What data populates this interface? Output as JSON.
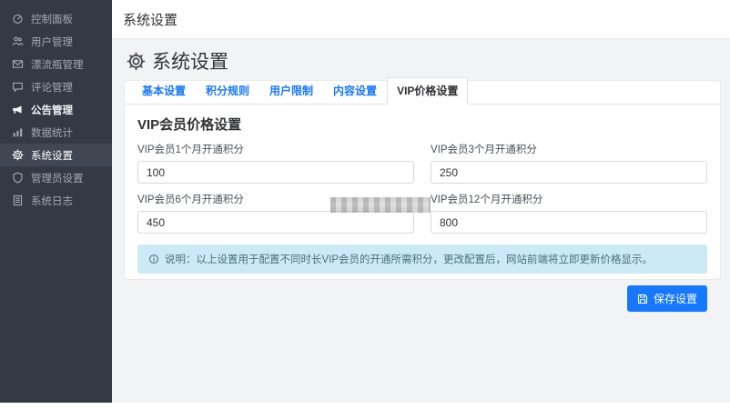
{
  "sidebar": {
    "items": [
      {
        "label": "控制面板",
        "icon": "dashboard-icon"
      },
      {
        "label": "用户管理",
        "icon": "users-icon"
      },
      {
        "label": "漂流瓶管理",
        "icon": "envelope-icon"
      },
      {
        "label": "评论管理",
        "icon": "comment-icon"
      },
      {
        "label": "公告管理",
        "icon": "megaphone-icon"
      },
      {
        "label": "数据统计",
        "icon": "bar-chart-icon"
      },
      {
        "label": "系统设置",
        "icon": "gear-icon"
      },
      {
        "label": "管理员设置",
        "icon": "admin-shield-icon"
      },
      {
        "label": "系统日志",
        "icon": "log-icon"
      }
    ],
    "active_item": "系统设置"
  },
  "topbar": {
    "title": "系统设置"
  },
  "page": {
    "title": "系统设置"
  },
  "tabs": {
    "items": [
      {
        "label": "基本设置"
      },
      {
        "label": "积分规则"
      },
      {
        "label": "用户限制"
      },
      {
        "label": "内容设置"
      },
      {
        "label": "VIP价格设置"
      }
    ],
    "active_tab": "VIP价格设置"
  },
  "form": {
    "section_title": "VIP会员价格设置",
    "fields": [
      {
        "label": "VIP会员1个月开通积分",
        "value": "100"
      },
      {
        "label": "VIP会员3个月开通积分",
        "value": "250"
      },
      {
        "label": "VIP会员6个月开通积分",
        "value": "450"
      },
      {
        "label": "VIP会员12个月开通积分",
        "value": "800"
      }
    ]
  },
  "notice": {
    "text": "说明：以上设置用于配置不同时长VIP会员的开通所需积分，更改配置后，网站前端将立即更新价格显示。"
  },
  "actions": {
    "save_label": "保存设置"
  },
  "colors": {
    "sidebar_bg": "#343943",
    "sidebar_active_bg": "#404652",
    "accent_blue": "#1677ff",
    "notice_bg": "#cbeaf5",
    "content_bg": "#f2f3f5"
  }
}
